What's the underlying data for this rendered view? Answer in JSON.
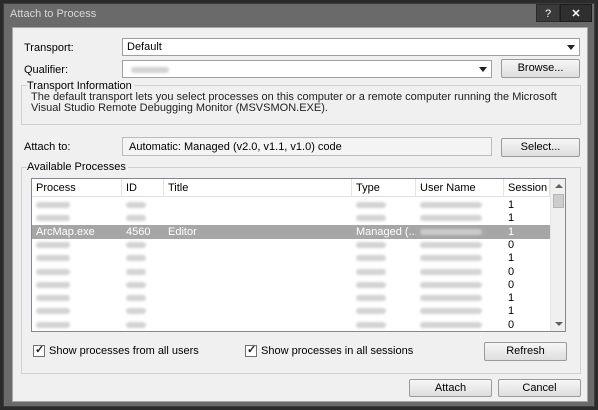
{
  "window": {
    "title": "Attach to Process",
    "help_glyph": "?",
    "close_glyph": "✕"
  },
  "transport": {
    "label": "Transport:",
    "value": "Default"
  },
  "qualifier": {
    "label": "Qualifier:",
    "value": "",
    "browse_label": "Browse..."
  },
  "transport_info": {
    "title": "Transport Information",
    "text": "The default transport lets you select processes on this computer or a remote computer running the Microsoft Visual Studio Remote Debugging Monitor (MSVSMON.EXE)."
  },
  "attach_to": {
    "label": "Attach to:",
    "value": "Automatic: Managed (v2.0, v1.1, v1.0) code",
    "select_label": "Select..."
  },
  "processes": {
    "title": "Available Processes",
    "columns": [
      "Process",
      "ID",
      "Title",
      "Type",
      "User Name",
      "Session"
    ],
    "rows": [
      {
        "process": "",
        "id": "",
        "title": "",
        "type": "",
        "user": "",
        "session": "1",
        "selected": false
      },
      {
        "process": "",
        "id": "",
        "title": "",
        "type": "",
        "user": "",
        "session": "1",
        "selected": false
      },
      {
        "process": "ArcMap.exe",
        "id": "4560",
        "title": "Editor",
        "type": "Managed (...",
        "user": "",
        "session": "1",
        "selected": true
      },
      {
        "process": "",
        "id": "",
        "title": "",
        "type": "",
        "user": "",
        "session": "0",
        "selected": false
      },
      {
        "process": "",
        "id": "",
        "title": "",
        "type": "",
        "user": "",
        "session": "1",
        "selected": false
      },
      {
        "process": "",
        "id": "",
        "title": "",
        "type": "",
        "user": "",
        "session": "0",
        "selected": false
      },
      {
        "process": "",
        "id": "",
        "title": "",
        "type": "",
        "user": "",
        "session": "0",
        "selected": false
      },
      {
        "process": "",
        "id": "",
        "title": "",
        "type": "",
        "user": "",
        "session": "1",
        "selected": false
      },
      {
        "process": "",
        "id": "",
        "title": "",
        "type": "",
        "user": "",
        "session": "1",
        "selected": false
      },
      {
        "process": "",
        "id": "",
        "title": "",
        "type": "",
        "user": "",
        "session": "0",
        "selected": false
      }
    ]
  },
  "options": {
    "all_users_label": "Show processes from all users",
    "all_users_checked": true,
    "all_sessions_label": "Show processes in all sessions",
    "all_sessions_checked": true,
    "refresh_label": "Refresh"
  },
  "footer": {
    "attach_label": "Attach",
    "cancel_label": "Cancel"
  }
}
